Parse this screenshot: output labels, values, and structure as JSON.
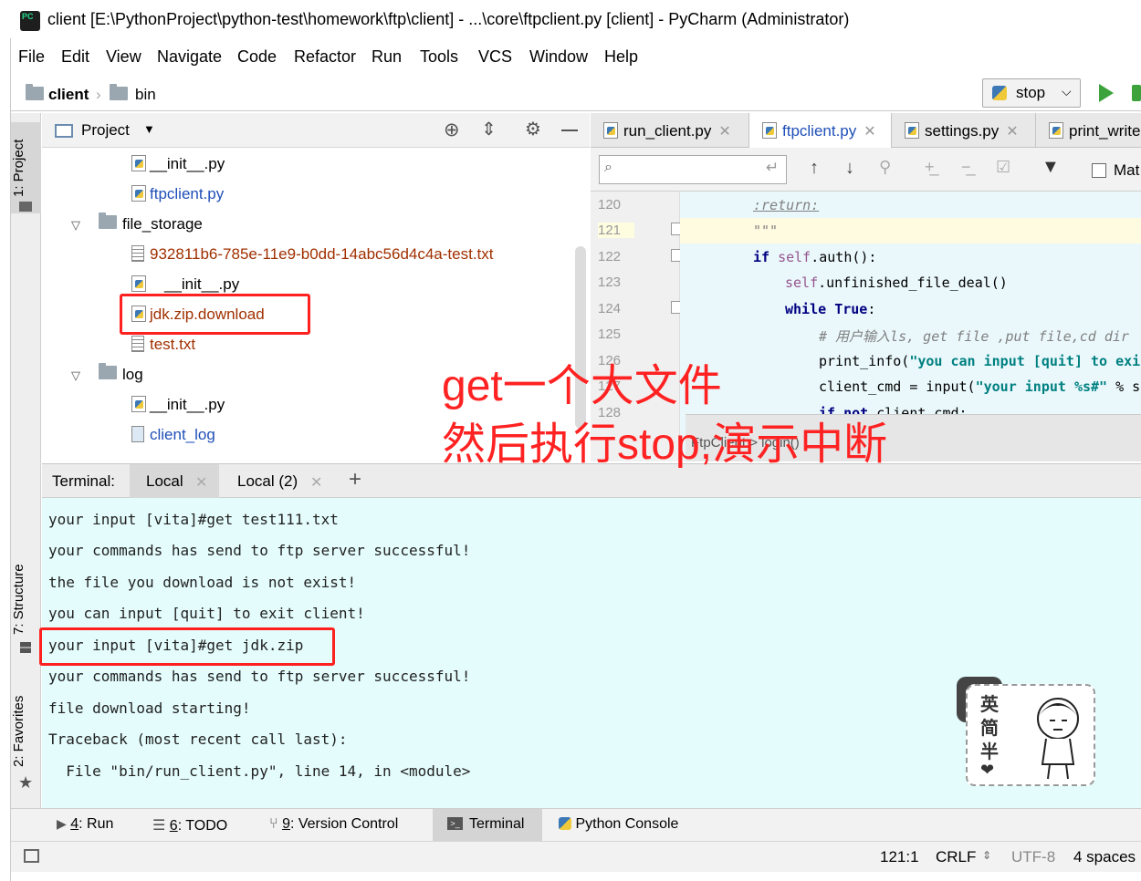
{
  "window": {
    "title": "client [E:\\PythonProject\\python-test\\homework\\ftp\\client] - ...\\core\\ftpclient.py [client] - PyCharm (Administrator)",
    "app_icon": "PC"
  },
  "menu": [
    "File",
    "Edit",
    "View",
    "Navigate",
    "Code",
    "Refactor",
    "Run",
    "Tools",
    "VCS",
    "Window",
    "Help"
  ],
  "nav": {
    "crumb1": "client",
    "crumb2": "bin",
    "run_config": "stop"
  },
  "left_strip": {
    "project": "1: Project",
    "structure": "7: Structure",
    "favorites": "2: Favorites"
  },
  "project": {
    "header": "Project",
    "tree": [
      {
        "label": "__init__.py",
        "color": "#000000"
      },
      {
        "label": "ftpclient.py",
        "color": "#1f4fb8"
      },
      {
        "label": "file_storage",
        "color": "#000000"
      },
      {
        "label": "932811b6-785e-11e9-b0dd-14abc56d4c4a-test.txt",
        "color": "#a03000"
      },
      {
        "label": "__init__.py",
        "color": "#000000"
      },
      {
        "label": "jdk.zip.download",
        "color": "#a03000"
      },
      {
        "label": "test.txt",
        "color": "#a03000"
      },
      {
        "label": "log",
        "color": "#000000"
      },
      {
        "label": "__init__.py",
        "color": "#000000"
      },
      {
        "label": "client_log",
        "color": "#1f4fb8"
      }
    ]
  },
  "editor": {
    "tabs": [
      "run_client.py",
      "ftpclient.py",
      "settings.py",
      "print_write"
    ],
    "search_option": "Mat",
    "line_numbers": [
      "120",
      "121",
      "122",
      "123",
      "124",
      "125",
      "126",
      "127",
      "128"
    ],
    "code": {
      "l120": ":return:",
      "l121": "\"\"\"",
      "l122a": "if",
      "l122b": "self",
      "l122c": ".auth():",
      "l123a": "self",
      "l123b": ".unfinished_file_deal()",
      "l124a": "while",
      "l124b": "True",
      ":": ":",
      "l125": "# 用户输入ls, get file ,put file,cd dir",
      "l126a": "print_info(",
      "l126b": "\"you can input [quit] to exit",
      "l127a": "client_cmd = input(",
      "l127b": "\"your input %s#\"",
      "l127c": " % se",
      "l128a": "if not",
      "l128b": " client_cmd:"
    },
    "breadcrumb": "FtpClient > login()"
  },
  "terminal": {
    "label": "Terminal:",
    "tabs": [
      "Local",
      "Local (2)"
    ],
    "lines": [
      "your input [vita]#get test111.txt",
      "your commands has send to ftp server successful!",
      "the file you download is not exist!",
      "you can input [quit] to exit client!",
      "your input [vita]#get jdk.zip",
      "your commands has send to ftp server successful!",
      "file download starting!",
      "Traceback (most recent call last):",
      "  File \"bin/run_client.py\", line 14, in <module>"
    ]
  },
  "annotation": {
    "line1": "get一个大文件",
    "line2": "然后执行stop,演示中断"
  },
  "sticker": {
    "c1": "英",
    "c2": "简",
    "c3": "半"
  },
  "bottom_tools": [
    {
      "num": "4",
      "label": ": Run"
    },
    {
      "num": "6",
      "label": ": TODO"
    },
    {
      "num": "9",
      "label": ": Version Control"
    },
    {
      "num": "",
      "label": "Terminal"
    },
    {
      "num": "",
      "label": "Python Console"
    }
  ],
  "status": {
    "position": "121:1",
    "line_sep": "CRLF",
    "encoding": "UTF-8",
    "indent": "4 spaces"
  },
  "colors": {
    "annotation": "#ff2020",
    "terminal_bg": "#e4fcfc",
    "editor_bg": "#eaf8fc"
  }
}
